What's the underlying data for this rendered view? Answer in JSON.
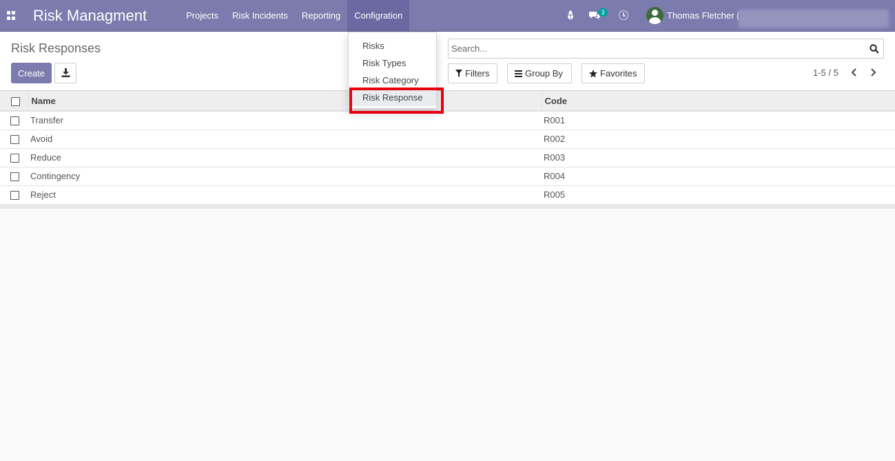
{
  "navbar": {
    "app_title": "Risk Managment",
    "menu": [
      {
        "label": "Projects"
      },
      {
        "label": "Risk Incidents"
      },
      {
        "label": "Reporting"
      },
      {
        "label": "Configration",
        "active": true
      }
    ],
    "chat_count": "3",
    "user_name": "Thomas Fletcher ("
  },
  "control_panel": {
    "breadcrumb": "Risk Responses",
    "create_label": "Create",
    "search_placeholder": "Search...",
    "filters_label": "Filters",
    "group_by_label": "Group By",
    "favorites_label": "Favorites",
    "pager": "1-5 / 5"
  },
  "dropdown": {
    "items": [
      "Risks",
      "Risk Types",
      "Risk Category",
      "Risk Response"
    ],
    "highlighted": "Risk Response"
  },
  "table": {
    "columns": [
      "Name",
      "Code"
    ],
    "rows": [
      {
        "name": "Transfer",
        "code": "R001"
      },
      {
        "name": "Avoid",
        "code": "R002"
      },
      {
        "name": "Reduce",
        "code": "R003"
      },
      {
        "name": "Contingency",
        "code": "R004"
      },
      {
        "name": "Reject",
        "code": "R005"
      }
    ]
  },
  "colors": {
    "brand": "#7c7bad",
    "highlight_border": "#e8000b",
    "badge": "#00a09d"
  }
}
